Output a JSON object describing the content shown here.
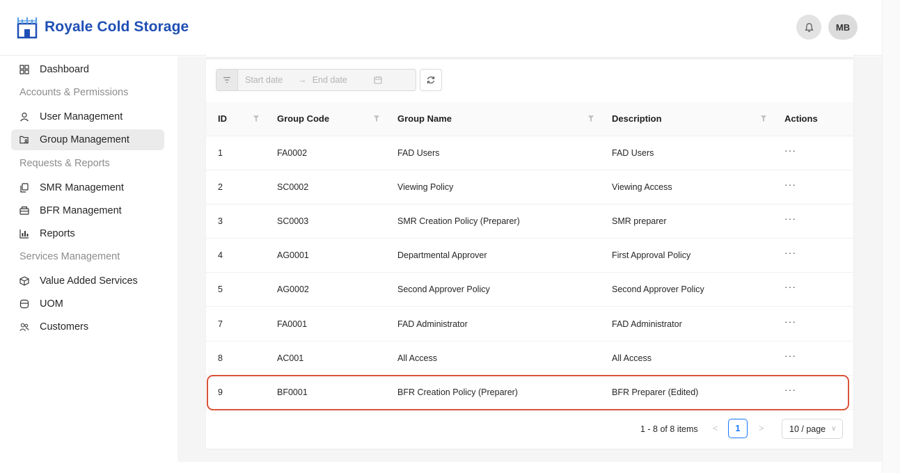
{
  "brand": {
    "name": "Royale Cold Storage",
    "color": "#1f4fb5"
  },
  "header": {
    "avatar_initials": "MB"
  },
  "sidebar": {
    "items": [
      {
        "label": "Dashboard",
        "icon": "dashboard-icon"
      },
      {
        "group": "Accounts & Permissions"
      },
      {
        "label": "User Management",
        "icon": "user-icon"
      },
      {
        "label": "Group Management",
        "icon": "group-folder-icon",
        "active": true
      },
      {
        "group": "Requests & Reports"
      },
      {
        "label": "SMR Management",
        "icon": "copy-icon"
      },
      {
        "label": "BFR Management",
        "icon": "printer-icon"
      },
      {
        "label": "Reports",
        "icon": "bar-chart-icon"
      },
      {
        "group": "Services Management"
      },
      {
        "label": "Value Added Services",
        "icon": "box-icon"
      },
      {
        "label": "UOM",
        "icon": "database-icon"
      },
      {
        "label": "Customers",
        "icon": "team-icon"
      }
    ]
  },
  "filters": {
    "start_placeholder": "Start date",
    "end_placeholder": "End date"
  },
  "table": {
    "columns": [
      "ID",
      "Group Code",
      "Group Name",
      "Description",
      "Actions"
    ],
    "rows": [
      {
        "id": "1",
        "code": "FA0002",
        "name": "FAD Users",
        "desc": "FAD Users"
      },
      {
        "id": "2",
        "code": "SC0002",
        "name": "Viewing Policy",
        "desc": "Viewing Access"
      },
      {
        "id": "3",
        "code": "SC0003",
        "name": "SMR Creation Policy (Preparer)",
        "desc": "SMR preparer"
      },
      {
        "id": "4",
        "code": "AG0001",
        "name": "Departmental Approver",
        "desc": "First Approval Policy"
      },
      {
        "id": "5",
        "code": "AG0002",
        "name": "Second Approver Policy",
        "desc": "Second Approver Policy"
      },
      {
        "id": "7",
        "code": "FA0001",
        "name": "FAD Administrator",
        "desc": "FAD Administrator"
      },
      {
        "id": "8",
        "code": "AC001",
        "name": "All Access",
        "desc": "All Access"
      },
      {
        "id": "9",
        "code": "BF0001",
        "name": "BFR Creation Policy (Preparer)",
        "desc": "BFR Preparer (Edited)"
      }
    ],
    "row_action": "···"
  },
  "pagination": {
    "info": "1 - 8 of 8 items",
    "current_page": "1",
    "page_size": "10 / page"
  },
  "colors": {
    "highlight": "#d9533a",
    "accent": "#1677ff"
  }
}
